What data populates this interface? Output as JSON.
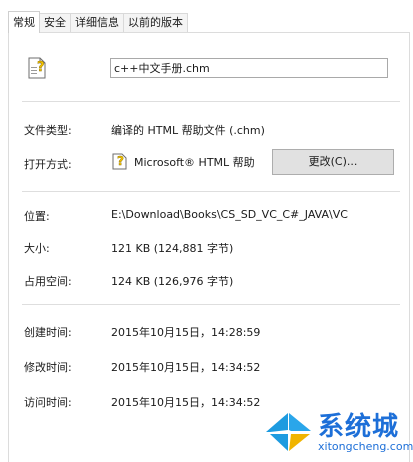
{
  "tabs": [
    {
      "label": "常规",
      "active": true
    },
    {
      "label": "安全",
      "active": false
    },
    {
      "label": "详细信息",
      "active": false
    },
    {
      "label": "以前的版本",
      "active": false
    }
  ],
  "file_name": "c++中文手册.chm",
  "file_type": {
    "label": "文件类型:",
    "value": "编译的 HTML 帮助文件 (.chm)"
  },
  "open_with": {
    "label": "打开方式:",
    "app": "Microsoft® HTML 帮助",
    "button_label": "更改(C)..."
  },
  "location": {
    "label": "位置:",
    "value": "E:\\Download\\Books\\CS_SD_VC_C#_JAVA\\VC"
  },
  "size": {
    "label": "大小:",
    "value": "121 KB (124,881 字节)"
  },
  "size_on_disk": {
    "label": "占用空间:",
    "value": "124 KB (126,976 字节)"
  },
  "created": {
    "label": "创建时间:",
    "value": "2015年10月15日，14:28:59"
  },
  "modified": {
    "label": "修改时间:",
    "value": "2015年10月15日，14:34:52"
  },
  "accessed": {
    "label": "访问时间:",
    "value": "2015年10月15日，14:34:52"
  },
  "watermark": {
    "brand": "系统城",
    "site": "xitongcheng.com"
  },
  "colors": {
    "accent": "#1d6fd8",
    "button_bg": "#e1e1e1",
    "icon_yellow": "#f2c200"
  },
  "icons": {
    "file": "chm-help-file-icon",
    "app": "html-help-app-icon",
    "logo": "windows-logo-icon"
  }
}
